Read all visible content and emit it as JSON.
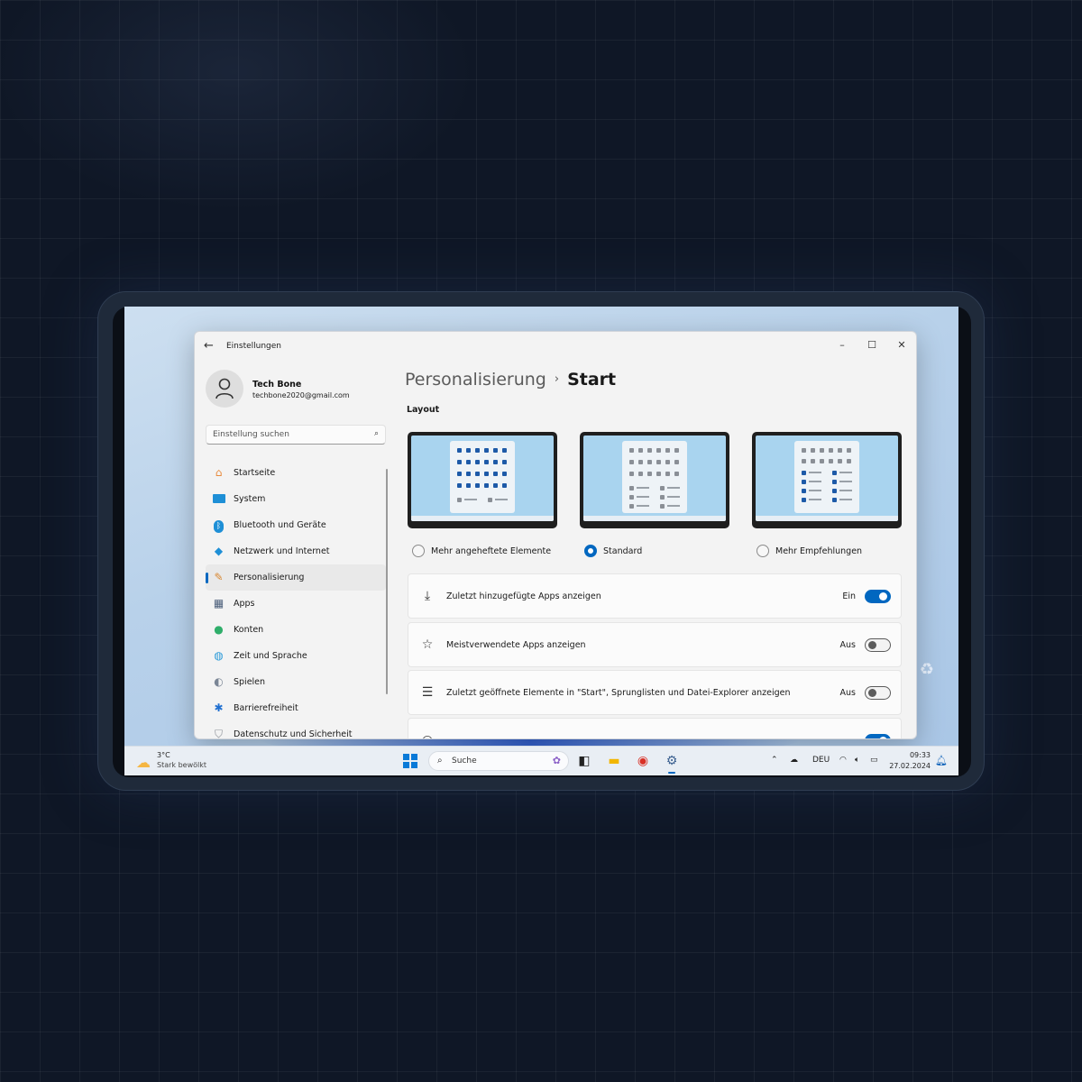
{
  "window": {
    "app_title": "Einstellungen",
    "controls": {
      "minimize": "–",
      "maximize": "☐",
      "close": "✕"
    }
  },
  "profile": {
    "name": "Tech Bone",
    "email": "techbone2020@gmail.com"
  },
  "search": {
    "placeholder": "Einstellung suchen"
  },
  "sidebar": {
    "items": [
      {
        "label": "Startseite",
        "icon": "home-icon"
      },
      {
        "label": "System",
        "icon": "monitor-icon"
      },
      {
        "label": "Bluetooth und Geräte",
        "icon": "bluetooth-icon"
      },
      {
        "label": "Netzwerk und Internet",
        "icon": "wifi-icon"
      },
      {
        "label": "Personalisierung",
        "icon": "brush-icon",
        "active": true
      },
      {
        "label": "Apps",
        "icon": "apps-icon"
      },
      {
        "label": "Konten",
        "icon": "user-icon"
      },
      {
        "label": "Zeit und Sprache",
        "icon": "globe-icon"
      },
      {
        "label": "Spielen",
        "icon": "gamepad-icon"
      },
      {
        "label": "Barrierefreiheit",
        "icon": "accessibility-icon"
      },
      {
        "label": "Datenschutz und Sicherheit",
        "icon": "shield-icon"
      }
    ]
  },
  "breadcrumb": {
    "parent": "Personalisierung",
    "separator": "›",
    "current": "Start"
  },
  "layout": {
    "title": "Layout",
    "options": [
      {
        "label": "Mehr angeheftete Elemente",
        "selected": false
      },
      {
        "label": "Standard",
        "selected": true
      },
      {
        "label": "Mehr Empfehlungen",
        "selected": false
      }
    ]
  },
  "settings": [
    {
      "label": "Zuletzt hinzugefügte Apps anzeigen",
      "state": "Ein",
      "on": true,
      "icon": "download-icon"
    },
    {
      "label": "Meistverwendete Apps anzeigen",
      "state": "Aus",
      "on": false,
      "icon": "star-icon"
    },
    {
      "label": "Zuletzt geöffnete Elemente in \"Start\", Sprunglisten und Datei-Explorer anzeigen",
      "state": "Aus",
      "on": false,
      "icon": "list-icon"
    }
  ],
  "taskbar": {
    "weather": {
      "temp": "3°C",
      "desc": "Stark bewölkt"
    },
    "search_label": "Suche",
    "language": "DEU",
    "time": "09:33",
    "date": "27.02.2024"
  },
  "colors": {
    "accent": "#0067c0",
    "window_bg": "#f3f3f3",
    "page_bg": "#0f1726"
  }
}
